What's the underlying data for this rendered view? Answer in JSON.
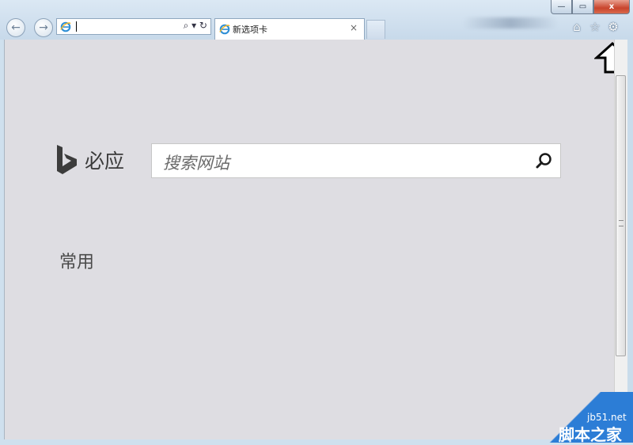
{
  "toolbar": {
    "address_value": "",
    "address_tools": "⌕ ▾ ↻"
  },
  "tab": {
    "label": "新选项卡",
    "close": "×"
  },
  "window": {
    "minimize": "—",
    "maximize": "▭",
    "close": "x"
  },
  "icons": {
    "home": "⌂",
    "favorites": "☆",
    "settings": "⚙"
  },
  "bing": {
    "brand": "必应",
    "search_placeholder": "搜索网站"
  },
  "section": {
    "frequent": "常用"
  },
  "watermark": {
    "site": "jb51.net",
    "name": "脚本之家"
  },
  "colors": {
    "page_bg": "#dedde2",
    "watermark_blue": "#2c7dd6"
  }
}
